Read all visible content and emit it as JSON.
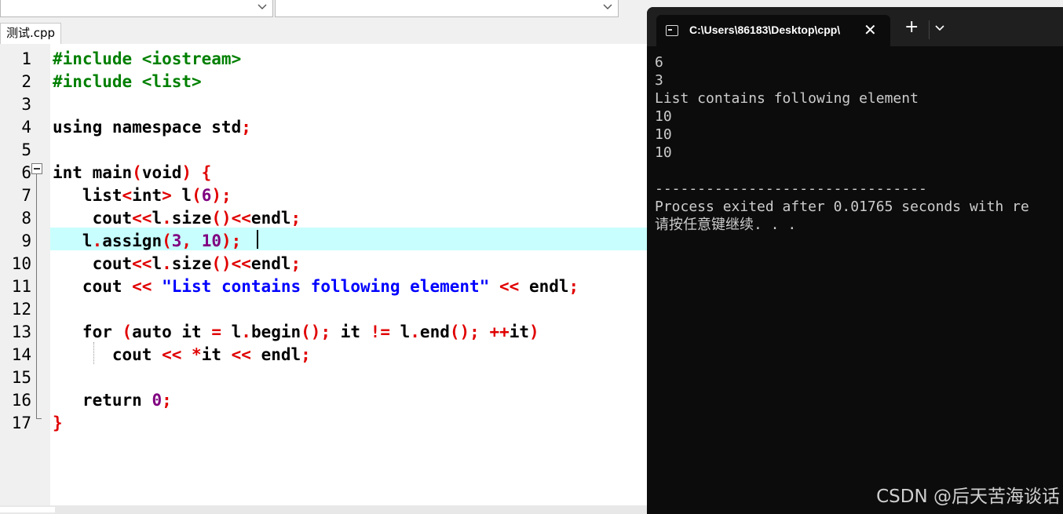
{
  "tab": {
    "filename": "测试.cpp"
  },
  "editor": {
    "line_numbers": [
      "1",
      "2",
      "3",
      "4",
      "5",
      "6",
      "7",
      "8",
      "9",
      "10",
      "11",
      "12",
      "13",
      "14",
      "15",
      "16",
      "17"
    ],
    "lines": [
      [
        {
          "t": "#include <iostream>",
          "c": "pre"
        }
      ],
      [
        {
          "t": "#include <list>",
          "c": "pre"
        }
      ],
      [],
      [
        {
          "t": "using namespace std"
        },
        {
          "t": ";",
          "c": "red"
        }
      ],
      [],
      [
        {
          "t": "int main"
        },
        {
          "t": "(",
          "c": "red"
        },
        {
          "t": "void"
        },
        {
          "t": ") {",
          "c": "red"
        }
      ],
      [
        {
          "t": "   list"
        },
        {
          "t": "<",
          "c": "red"
        },
        {
          "t": "int"
        },
        {
          "t": ">",
          "c": "red"
        },
        {
          "t": " l"
        },
        {
          "t": "(",
          "c": "red"
        },
        {
          "t": "6",
          "c": "num"
        },
        {
          "t": ");",
          "c": "red"
        }
      ],
      [
        {
          "t": "    cout"
        },
        {
          "t": "<<",
          "c": "red"
        },
        {
          "t": "l"
        },
        {
          "t": ".",
          "c": "red"
        },
        {
          "t": "size"
        },
        {
          "t": "()<<",
          "c": "red"
        },
        {
          "t": "endl"
        },
        {
          "t": ";",
          "c": "red"
        }
      ],
      [
        {
          "t": "   l"
        },
        {
          "t": ".",
          "c": "red"
        },
        {
          "t": "assign"
        },
        {
          "t": "(",
          "c": "red"
        },
        {
          "t": "3",
          "c": "num"
        },
        {
          "t": ", ",
          "c": "red"
        },
        {
          "t": "10",
          "c": "num"
        },
        {
          "t": ");",
          "c": "red"
        }
      ],
      [
        {
          "t": "    cout"
        },
        {
          "t": "<<",
          "c": "red"
        },
        {
          "t": "l"
        },
        {
          "t": ".",
          "c": "red"
        },
        {
          "t": "size"
        },
        {
          "t": "()<<",
          "c": "red"
        },
        {
          "t": "endl"
        },
        {
          "t": ";",
          "c": "red"
        }
      ],
      [
        {
          "t": "   cout "
        },
        {
          "t": "<<",
          "c": "red"
        },
        {
          "t": " "
        },
        {
          "t": "\"List contains following element\"",
          "c": "str"
        },
        {
          "t": " "
        },
        {
          "t": "<<",
          "c": "red"
        },
        {
          "t": " endl"
        },
        {
          "t": ";",
          "c": "red"
        }
      ],
      [],
      [
        {
          "t": "   for "
        },
        {
          "t": "(",
          "c": "red"
        },
        {
          "t": "auto it "
        },
        {
          "t": "=",
          "c": "red"
        },
        {
          "t": " l"
        },
        {
          "t": ".",
          "c": "red"
        },
        {
          "t": "begin"
        },
        {
          "t": "();",
          "c": "red"
        },
        {
          "t": " it "
        },
        {
          "t": "!=",
          "c": "red"
        },
        {
          "t": " l"
        },
        {
          "t": ".",
          "c": "red"
        },
        {
          "t": "end"
        },
        {
          "t": "();",
          "c": "red"
        },
        {
          "t": " "
        },
        {
          "t": "++",
          "c": "red"
        },
        {
          "t": "it"
        },
        {
          "t": ")",
          "c": "red"
        }
      ],
      [
        {
          "t": "      cout "
        },
        {
          "t": "<<",
          "c": "red"
        },
        {
          "t": " "
        },
        {
          "t": "*",
          "c": "red"
        },
        {
          "t": "it "
        },
        {
          "t": "<<",
          "c": "red"
        },
        {
          "t": " endl"
        },
        {
          "t": ";",
          "c": "red"
        }
      ],
      [],
      [
        {
          "t": "   return "
        },
        {
          "t": "0",
          "c": "num"
        },
        {
          "t": ";",
          "c": "red"
        }
      ],
      [
        {
          "t": "}",
          "c": "red"
        }
      ]
    ]
  },
  "terminal": {
    "tab_title": "C:\\Users\\86183\\Desktop\\cpp\\",
    "new_tab_label": "+",
    "close_label": "✕",
    "output": "6\n3\nList contains following element\n10\n10\n10\n\n--------------------------------\nProcess exited after 0.01765 seconds with re\n请按任意键继续. . ."
  },
  "watermark": "CSDN @后天苦海谈话"
}
